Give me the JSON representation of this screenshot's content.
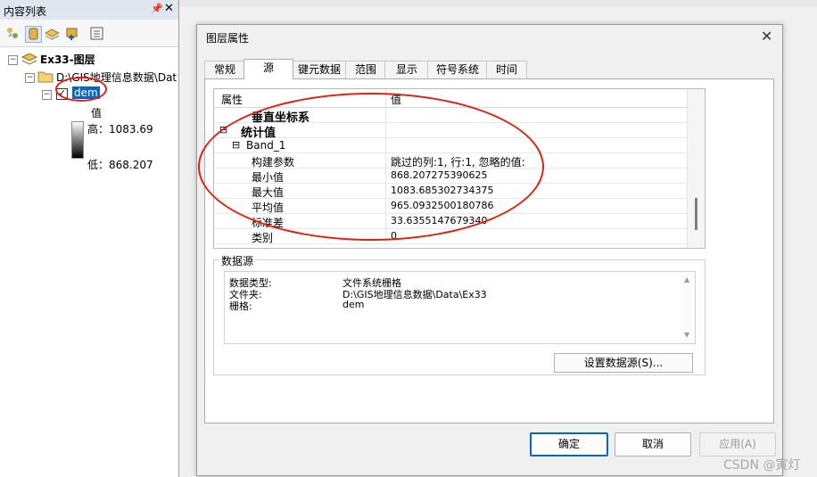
{
  "toc": {
    "title": "内容列表",
    "pin_glyph": "ᵖ",
    "close_glyph": "✕",
    "tree": {
      "root": "Ex33-图层",
      "folder": "D:\\GIS地理信息数据\\Dat",
      "layer": "dem",
      "legend_value": "值",
      "legend_high": "高：1083.69",
      "legend_low": "低：868.207"
    }
  },
  "dialog": {
    "title": "图层属性",
    "tabs": [
      "常规",
      "源",
      "键元数据",
      "范围",
      "显示",
      "符号系统",
      "时间"
    ],
    "active_tab": "源",
    "grid": {
      "col_property": "属性",
      "col_value": "值",
      "rows": [
        {
          "indent": 2,
          "toggle": "",
          "name": "垂直坐标系",
          "value": "",
          "bold": true
        },
        {
          "indent": 0,
          "toggle": "⊟",
          "name": "统计值",
          "value": "",
          "bold": true
        },
        {
          "indent": 1,
          "toggle": "⊟",
          "name": "Band_1",
          "value": "",
          "bold": false
        },
        {
          "indent": 2,
          "toggle": "",
          "name": "构建参数",
          "value": "跳过的列:1, 行:1, 忽略的值:",
          "bold": false
        },
        {
          "indent": 2,
          "toggle": "",
          "name": "最小值",
          "value": "868.207275390625",
          "bold": false
        },
        {
          "indent": 2,
          "toggle": "",
          "name": "最大值",
          "value": "1083.685302734375",
          "bold": false
        },
        {
          "indent": 2,
          "toggle": "",
          "name": "平均值",
          "value": "965.0932500180786",
          "bold": false
        },
        {
          "indent": 2,
          "toggle": "",
          "name": "标准差",
          "value": "33.6355147679340",
          "bold": false
        },
        {
          "indent": 2,
          "toggle": "",
          "name": "类别",
          "value": "0",
          "bold": false
        }
      ]
    },
    "datasource": {
      "legend": "数据源",
      "rows": [
        {
          "label": "数据类型:",
          "value": "文件系统栅格"
        },
        {
          "label": "文件夹:",
          "value": "D:\\GIS地理信息数据\\Data\\Ex33"
        },
        {
          "label": "栅格:",
          "value": "dem"
        }
      ],
      "set_button": "设置数据源(S)..."
    },
    "buttons": {
      "ok": "确定",
      "cancel": "取消",
      "apply": "应用(A)"
    }
  },
  "watermark": "CSDN @寅灯",
  "colors": {
    "annotation_red": "#e02010",
    "selection_blue": "#0a64c8"
  }
}
